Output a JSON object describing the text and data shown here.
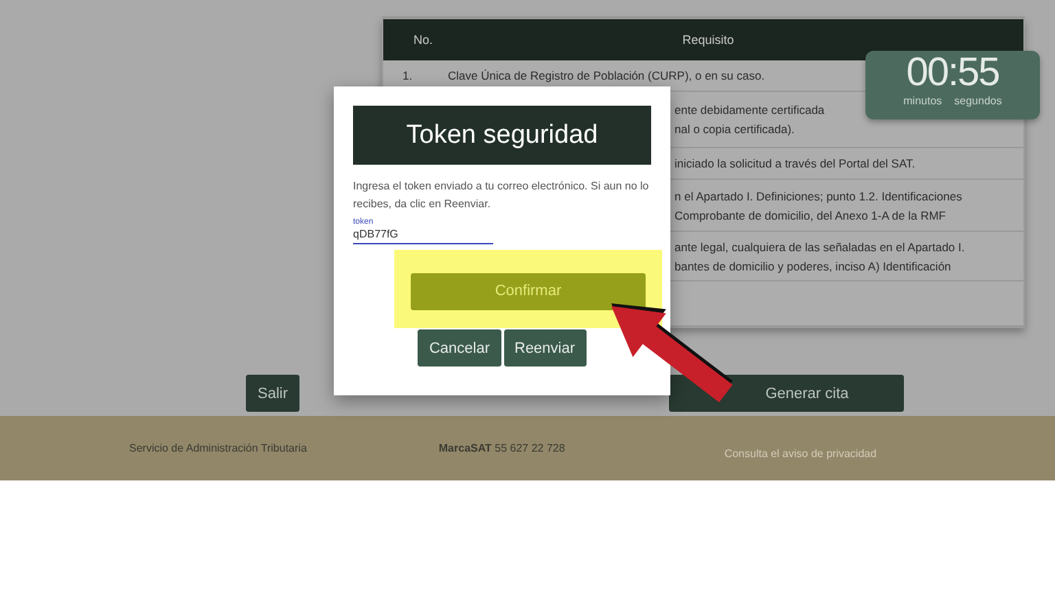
{
  "table": {
    "columns": [
      "No.",
      "Requisito"
    ],
    "rows": [
      {
        "number": "1.",
        "lines": [
          "Clave Única de Registro de Población (CURP), o en su caso."
        ],
        "kind": "full"
      },
      {
        "lines": [
          "ente debidamente certificada",
          "nal o copia certificada)."
        ],
        "kind": "cut"
      },
      {
        "lines": [
          "iniciado la solicitud a través del Portal del SAT."
        ],
        "kind": "cut"
      },
      {
        "lines": [
          "n el Apartado I. Definiciones; punto 1.2. Identificaciones",
          "Comprobante de domicilio, del Anexo 1-A de la RMF"
        ],
        "kind": "cut"
      },
      {
        "lines": [
          "ante legal, cualquiera de las señaladas en el Apartado I.",
          "bantes de domicilio y poderes, inciso A) Identificación"
        ],
        "kind": "cut"
      },
      {
        "lines": [],
        "kind": "empty"
      }
    ]
  },
  "timer": {
    "value": "00:55",
    "labels": [
      "minutos",
      "segundos"
    ]
  },
  "buttons": {
    "exit": "Salir",
    "generate": "Generar cita"
  },
  "footer": {
    "org": "Servicio de Administración Tributaria",
    "contact": "**MarcaSAT** 55 627 22 728",
    "privacy": "Consulta el aviso de privacidad"
  },
  "modal": {
    "title": "Token seguridad",
    "message": "Ingresa el token enviado a tu correo electrónico. Si aun no lo recibes, da clic en Reenviar.",
    "field_label": "token",
    "field_value": "qDB77fG",
    "confirm": "Confirmar",
    "cancel": "Cancelar",
    "resend": "Reenviar"
  }
}
